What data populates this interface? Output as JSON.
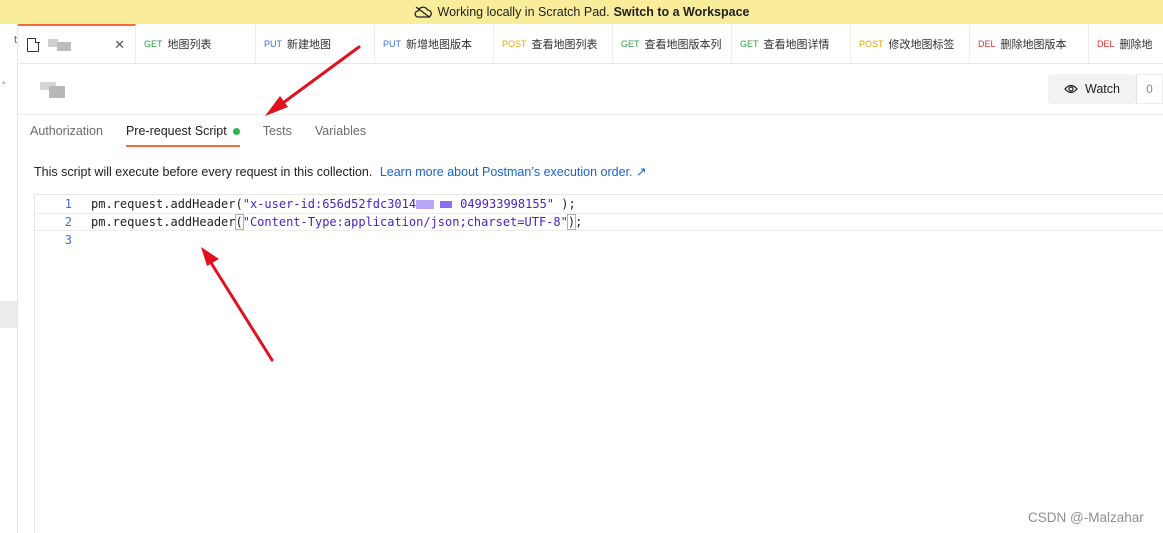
{
  "banner": {
    "text": "Working locally in Scratch Pad.",
    "link": "Switch to a Workspace",
    "icon": "cloud-offline-icon"
  },
  "left_rail": {
    "top_glyph": "t",
    "dot_glyph": "°"
  },
  "tabs": [
    {
      "method": "GET",
      "title": "地图列表",
      "color": "#2e9b43"
    },
    {
      "method": "PUT",
      "title": "新建地图",
      "color": "#3d6fd1"
    },
    {
      "method": "PUT",
      "title": "新增地图版本",
      "color": "#3d6fd1"
    },
    {
      "method": "POST",
      "title": "查看地图列表",
      "color": "#e6a700"
    },
    {
      "method": "GET",
      "title": "查看地图版本列",
      "color": "#2e9b43"
    },
    {
      "method": "GET",
      "title": "查看地图详情",
      "color": "#2e9b43"
    },
    {
      "method": "POST",
      "title": "修改地图标签",
      "color": "#e6a700"
    },
    {
      "method": "DEL",
      "title": "删除地图版本",
      "color": "#d32f2f"
    },
    {
      "method": "DEL",
      "title": "删除地",
      "color": "#d32f2f"
    }
  ],
  "active_tab": {
    "close_glyph": "✕",
    "icon": "document-icon"
  },
  "watch": {
    "label": "Watch",
    "count": "0",
    "icon": "eye-icon"
  },
  "subtabs": [
    {
      "label": "Authorization",
      "active": false
    },
    {
      "label": "Pre-request Script",
      "active": true,
      "status_color": "#2fb344"
    },
    {
      "label": "Tests",
      "active": false
    },
    {
      "label": "Variables",
      "active": false
    }
  ],
  "description": {
    "text": "This script will execute before every request in this collection.",
    "link": "Learn more about Postman’s execution order. ↗"
  },
  "editor": {
    "lines": [
      {
        "number": "1",
        "prefix": "pm.request.addHeader(",
        "string_a": "\"x-user-id:656d52fdc3014",
        "string_b": "049933998155\"",
        "suffix": " );"
      },
      {
        "number": "2",
        "prefix": "pm.request.addHeader",
        "open": "(",
        "string": "\"Content-Type:application/json;charset=UTF-8\"",
        "close": ")",
        "suffix": ";"
      },
      {
        "number": "3"
      }
    ]
  },
  "accent_color": "#f26b3a",
  "watermark": "CSDN @-Malzahar"
}
